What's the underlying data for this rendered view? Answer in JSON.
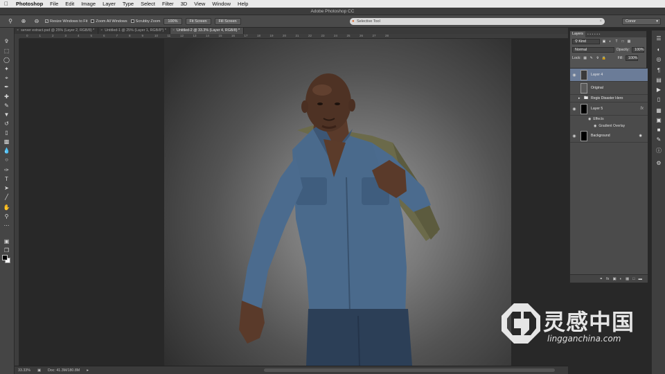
{
  "menubar": {
    "app": "Photoshop",
    "items": [
      "File",
      "Edit",
      "Image",
      "Layer",
      "Type",
      "Select",
      "Filter",
      "3D",
      "View",
      "Window",
      "Help"
    ]
  },
  "title": "Adobe Photoshop CC",
  "options": {
    "resize_windows": "Resize Windows to Fit",
    "zoom_all": "Zoom All Windows",
    "scrubby_zoom": "Scrubby Zoom",
    "zoom_100": "100%",
    "fit_screen": "Fit Screen",
    "fill_screen": "Fill Screen",
    "search_text": "Selective Tool",
    "workspace": "Conor"
  },
  "tabs": [
    {
      "label": "server extract.psd @ 25% (Layer 2, RGB/8) *",
      "active": false
    },
    {
      "label": "Untitled-1 @ 25% (Layer 1, RGB/8*) *",
      "active": false
    },
    {
      "label": "Untitled-2 @ 33.3% (Layer 4, RGB/8) *",
      "active": true
    }
  ],
  "ruler_ticks": [
    "0",
    "1",
    "2",
    "3",
    "4",
    "5",
    "6",
    "7",
    "8",
    "9",
    "10",
    "11",
    "12",
    "13",
    "14",
    "15",
    "16",
    "17",
    "18",
    "19",
    "20",
    "21",
    "22",
    "23",
    "24",
    "25",
    "26",
    "27",
    "28"
  ],
  "status": {
    "zoom": "33.33%",
    "doc": "Doc: 41.3M/180.8M"
  },
  "layers_panel": {
    "tabs": [
      "Layers"
    ],
    "kind": "Kind",
    "blend_mode": "Normal",
    "opacity_label": "Opacity:",
    "opacity_value": "100%",
    "lock_label": "Lock:",
    "fill_label": "Fill:",
    "fill_value": "100%",
    "layers": [
      {
        "name": "Layer 4",
        "selected": true
      },
      {
        "name": "Original",
        "selected": false
      },
      {
        "name": "Regis Disaster Hero",
        "selected": false
      },
      {
        "name": "Layer 5",
        "selected": false
      },
      {
        "name": "Background",
        "selected": false
      }
    ],
    "effects_label": "Effects",
    "gradient_overlay": "Gradient Overlay",
    "fx": "fx"
  },
  "watermark": {
    "chinese": "灵感中国",
    "url": "lingganchina.com"
  },
  "icons": [
    "apple-icon",
    "zoom-tool-icon",
    "move-icon",
    "marquee-icon",
    "lasso-icon",
    "quick-select-icon",
    "crop-icon",
    "eyedropper-icon",
    "healing-icon",
    "brush-icon",
    "stamp-icon",
    "history-brush-icon",
    "eraser-icon",
    "gradient-icon",
    "blur-icon",
    "dodge-icon",
    "pen-icon",
    "type-icon",
    "path-select-icon",
    "shape-icon",
    "hand-icon",
    "zoom-icon",
    "eye-icon",
    "folder-icon"
  ]
}
